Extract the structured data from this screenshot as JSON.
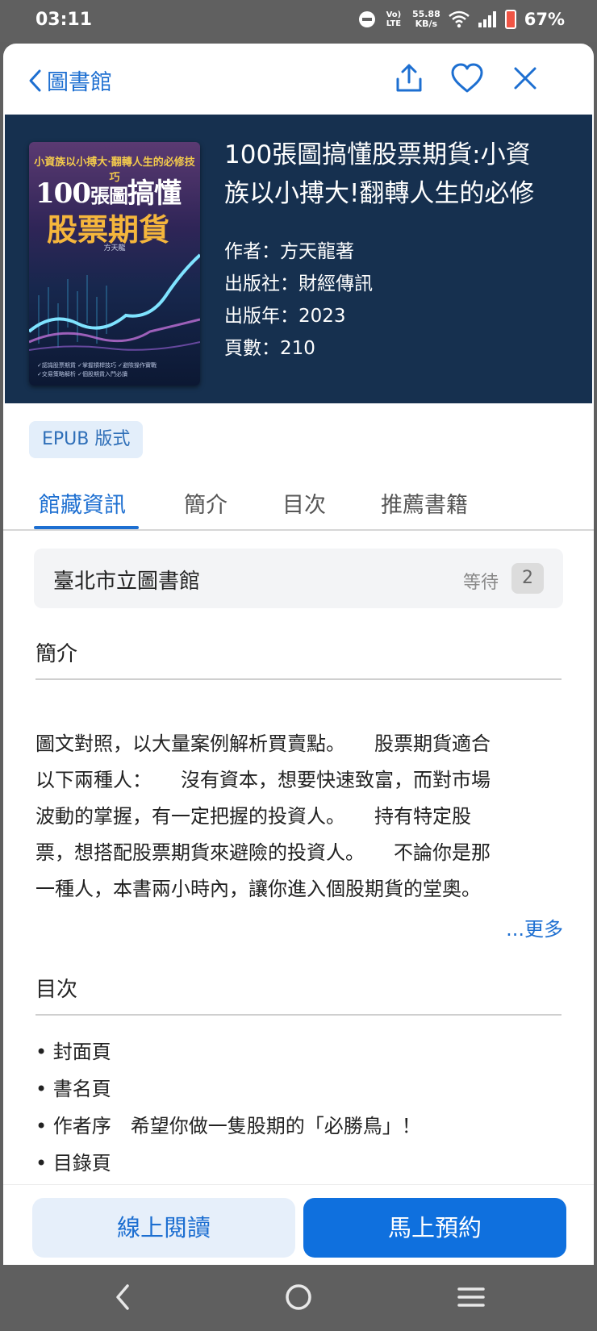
{
  "status_bar": {
    "time": "03:11",
    "network_type": "Vo) LTE",
    "speed_value": "55.88",
    "speed_unit": "KB/s",
    "battery": "67%"
  },
  "nav": {
    "back_label": "圖書館",
    "icons": [
      "share-icon",
      "heart-icon",
      "close-icon"
    ]
  },
  "book": {
    "title": "100張圖搞懂股票期貨:小資族以小搏大!翻轉人生的必修",
    "title_lines": [
      "100張圖搞懂股票期貨:小資",
      "族以小搏大!翻轉人生的必修"
    ],
    "author": "作者：方天龍著",
    "publisher": "出版社：財經傳訊",
    "year": "出版年：2023",
    "pages": "頁數：210",
    "cover": {
      "subtitle": "小資族以小搏大·翻轉人生的必修技巧",
      "line1_a": "100",
      "line1_b": "張圖",
      "line1_c": "搞懂",
      "line2": "股票期貨",
      "author": "方天龍",
      "foot_a": "✓認識股票期貨 ✓掌握槓桿技巧 ✓避險操作實戰",
      "foot_b": "✓交易策略解析 ✓個股期貨入門必讀"
    }
  },
  "format_badge": "EPUB 版式",
  "tabs": [
    {
      "label": "館藏資訊",
      "active": true
    },
    {
      "label": "簡介",
      "active": false
    },
    {
      "label": "目次",
      "active": false
    },
    {
      "label": "推薦書籍",
      "active": false
    }
  ],
  "library": {
    "name": "臺北市立圖書館",
    "wait_label": "等待",
    "wait_count": "2"
  },
  "summary": {
    "heading": "簡介",
    "lines": [
      "圖文對照，以大量案例解析買賣點。　　股票期貨適合",
      "以下兩種人：　　沒有資本，想要快速致富，而對市場",
      "波動的掌握，有一定把握的投資人。　　持有特定股",
      "票，想搭配股票期貨來避險的投資人。　　不論你是那",
      "一種人，本書兩小時內，讓你進入個股期貨的堂奧。"
    ],
    "more_label": "...更多"
  },
  "toc": {
    "heading": "目次",
    "items": [
      "• 封面頁",
      "• 書名頁",
      "• 作者序　希望你做一隻股期的「必勝鳥」！",
      "• 目錄頁"
    ]
  },
  "actions": {
    "read_online": "線上閱讀",
    "reserve": "馬上預約"
  },
  "colors": {
    "accent": "#1d6fd1",
    "hero_bg": "#16304f",
    "reserve_bg": "#0f70de"
  }
}
